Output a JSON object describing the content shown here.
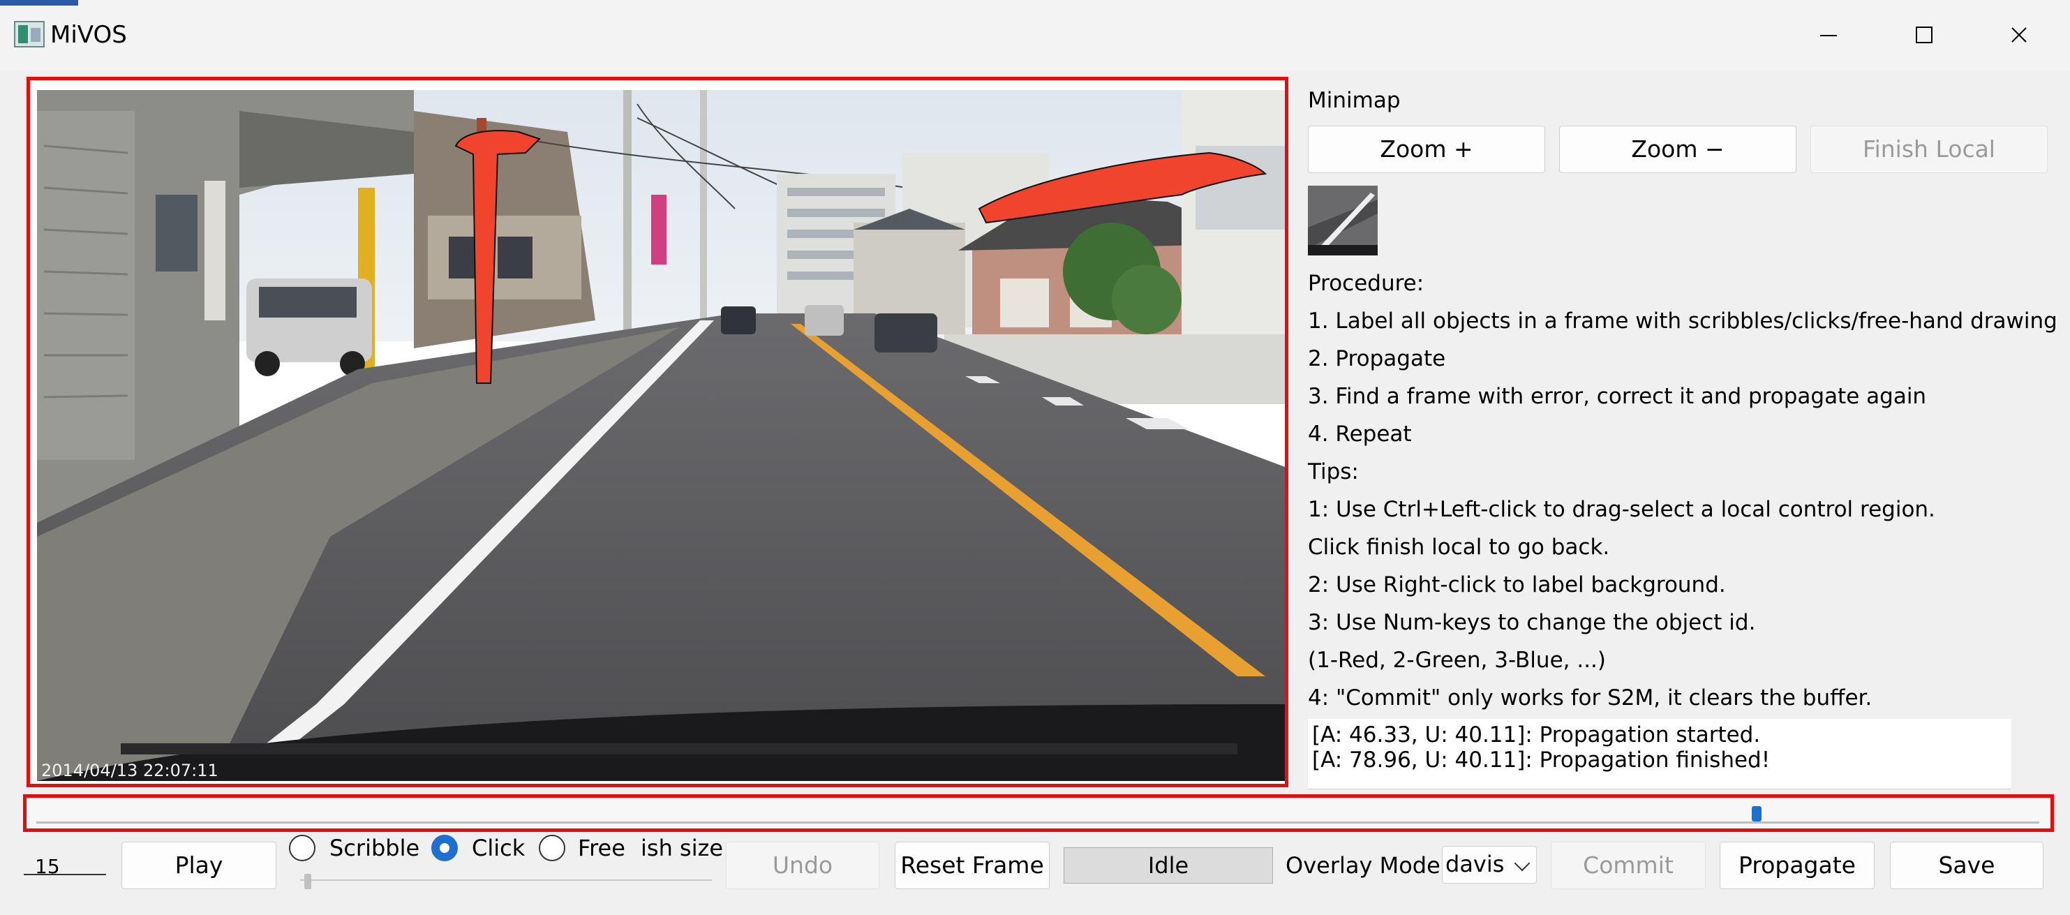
{
  "window": {
    "title": "MiVOS"
  },
  "canvas": {
    "timestamp": "2014/04/13 22:07:11"
  },
  "minimap": {
    "label": "Minimap"
  },
  "buttons": {
    "zoom_plus": "Zoom +",
    "zoom_minus": "Zoom −",
    "finish_local": "Finish Local",
    "play": "Play",
    "undo": "Undo",
    "reset_frame": "Reset Frame",
    "commit": "Commit",
    "propagate": "Propagate",
    "save": "Save"
  },
  "instructions": {
    "procedure_heading": "Procedure:",
    "steps": [
      "1. Label all objects in a frame with scribbles/clicks/free-hand drawing",
      "2. Propagate",
      "3. Find a frame with error, correct it and propagate again",
      "4. Repeat"
    ],
    "tips_heading": "Tips:",
    "tips": [
      "1: Use Ctrl+Left-click to drag-select a local control region.",
      "Click finish local to go back.",
      "2: Use Right-click to label background.",
      "3: Use Num-keys to change the object id.",
      "(1-Red, 2-Green, 3-Blue, ...)",
      "4: \"Commit\" only works for S2M, it clears the buffer."
    ]
  },
  "log": [
    "[A: 46.33, U: 40.11]: Propagation started.",
    "[A: 78.96, U: 40.11]: Propagation finished!"
  ],
  "timeline": {
    "position_fraction": 0.86
  },
  "frame_counter": "15",
  "interaction_modes": {
    "options": [
      "Scribble",
      "Click",
      "Free"
    ],
    "selected": "Click",
    "brush_size_label": "ish size"
  },
  "status": "Idle",
  "overlay": {
    "label": "Overlay Mode",
    "selected": "davis"
  },
  "colors": {
    "mask_red": "#f0442c",
    "highlight_border": "#e01010",
    "accent": "#1e6fd0"
  }
}
